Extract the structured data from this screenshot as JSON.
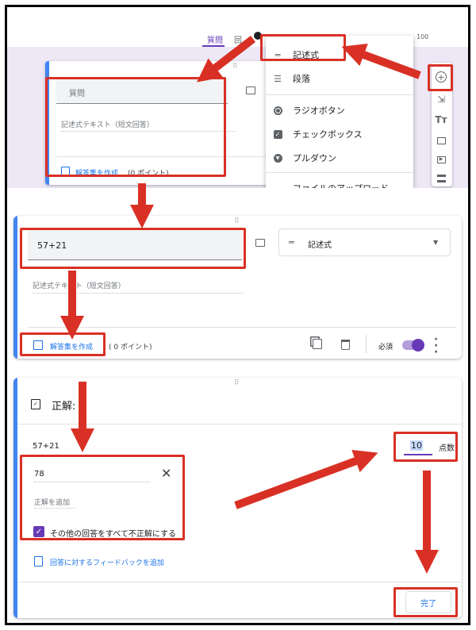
{
  "panel1": {
    "tabs": {
      "questions": "質問",
      "responses_partial": "回",
      "points_suffix": "100"
    },
    "question_placeholder": "質問",
    "short_answer_hint": "記述式テキスト（短文回答）",
    "answer_key_link": "解答集を作成",
    "points_text": "(0 ポイント)",
    "menu": {
      "items": [
        {
          "label": "記述式",
          "icon": "short-answer-icon"
        },
        {
          "label": "段落",
          "icon": "paragraph-icon"
        },
        {
          "label": "ラジオボタン",
          "icon": "radio-icon"
        },
        {
          "label": "チェックボックス",
          "icon": "checkbox-icon"
        },
        {
          "label": "プルダウン",
          "icon": "dropdown-icon"
        },
        {
          "label": "ファイルのアップロード",
          "icon": "upload-icon"
        }
      ]
    }
  },
  "panel2": {
    "question_value": "57+21",
    "type_select": "記述式",
    "short_answer_hint": "記述式テキスト（短文回答）",
    "answer_key_link": "解答集を作成",
    "points_text": "( 0 ポイント)",
    "required_label": "必須"
  },
  "panel3": {
    "title": "正解:",
    "question_text": "57+21",
    "points_value": "10",
    "points_label": "点数",
    "answer_value": "78",
    "add_answer": "正解を追加",
    "mark_incorrect": "その他の回答をすべて不正解にする",
    "feedback_link": "回答に対するフィードバックを追加",
    "done_button": "完了"
  },
  "colors": {
    "accent_red": "#d93025",
    "google_blue": "#1a73e8",
    "purple": "#673ab7"
  }
}
